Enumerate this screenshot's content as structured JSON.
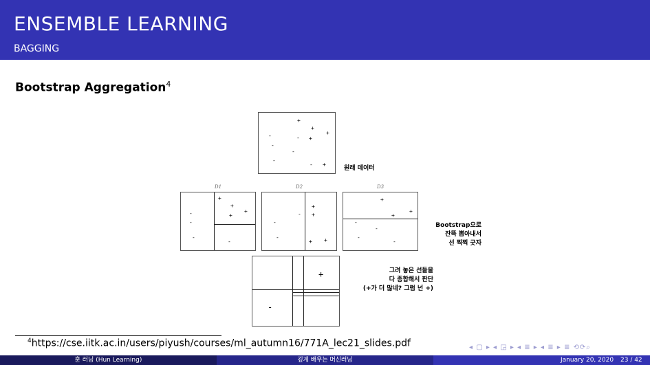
{
  "header": {
    "title": "ENSEMBLE LEARNING",
    "subtitle": "BAGGING"
  },
  "frame": {
    "title": "Bootstrap Aggregation",
    "footnote_mark": "4"
  },
  "diagram": {
    "original_label": "원래 데이터",
    "subset_labels": [
      "D1",
      "D2",
      "D3"
    ],
    "bootstrap_note": [
      "Bootstrap으로",
      "잔뜩 뽑아내서",
      "선 찍찍 긋자"
    ],
    "aggregate_note": [
      "그려 놓은 선들을",
      "다 종합해서 판단",
      "(+가 더 많네? 그럼 넌 +)"
    ],
    "final_plus": "+",
    "final_minus": "-"
  },
  "footnote": {
    "mark": "4",
    "text": "https://cse.iitk.ac.in/users/piyush/courses/ml_autumn16/771A_lec21_slides.pdf"
  },
  "nav": {
    "symbols": "◂ ▢ ▸ ◂ ◲ ▸ ◂ ≣ ▸ ◂ ≣ ▸  ≣  ⟲⟳⌕"
  },
  "footer": {
    "author": "훈 러닝 (Hun Learning)",
    "course": "깊게 배우는 머신러닝",
    "date": "January 20, 2020",
    "page": "23 / 42"
  },
  "colors": {
    "header": "#3333b3",
    "footer_left": "#1a1a5c",
    "footer_mid": "#26268a",
    "footer_right": "#3333b3"
  }
}
